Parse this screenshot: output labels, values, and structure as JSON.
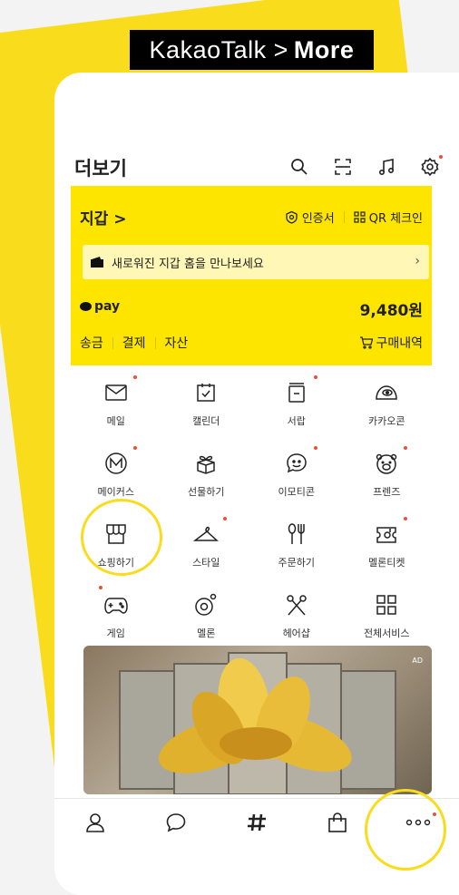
{
  "caption": {
    "app": "KakaoTalk",
    "arrow": ">",
    "section": "More"
  },
  "header": {
    "title": "더보기"
  },
  "wallet": {
    "title": "지갑 >",
    "links": [
      "인증서",
      "QR 체크인"
    ],
    "banner": "새로워진 지갑 홈을 만나보세요",
    "pay_label": "pay",
    "balance": "9,480원",
    "actions": [
      "송금",
      "결제",
      "자산"
    ],
    "purchase": "구매내역"
  },
  "grid": [
    [
      {
        "label": "메일",
        "icon": "mail-icon"
      },
      {
        "label": "캘린더",
        "icon": "calendar-icon"
      },
      {
        "label": "서랍",
        "icon": "drawer-icon"
      },
      {
        "label": "카카오콘",
        "icon": "kakaocon-icon"
      }
    ],
    [
      {
        "label": "메이커스",
        "icon": "makers-icon"
      },
      {
        "label": "선물하기",
        "icon": "gift-icon"
      },
      {
        "label": "이모티콘",
        "icon": "emoticon-icon"
      },
      {
        "label": "프렌즈",
        "icon": "friends-icon"
      }
    ],
    [
      {
        "label": "쇼핑하기",
        "icon": "shopping-icon"
      },
      {
        "label": "스타일",
        "icon": "style-icon"
      },
      {
        "label": "주문하기",
        "icon": "order-icon"
      },
      {
        "label": "멜론티켓",
        "icon": "melon-ticket-icon"
      }
    ],
    [
      {
        "label": "게임",
        "icon": "game-icon"
      },
      {
        "label": "멜론",
        "icon": "melon-icon"
      },
      {
        "label": "헤어샵",
        "icon": "hairshop-icon"
      },
      {
        "label": "전체서비스",
        "icon": "all-services-icon"
      }
    ]
  ],
  "ad": {
    "badge": "AD"
  },
  "tabs": [
    "friends-tab",
    "chats-tab",
    "view-tab",
    "shopping-tab",
    "more-tab"
  ],
  "colors": {
    "accent": "#fde500",
    "notification": "#e8503b",
    "highlight": "#f9dc1c"
  }
}
